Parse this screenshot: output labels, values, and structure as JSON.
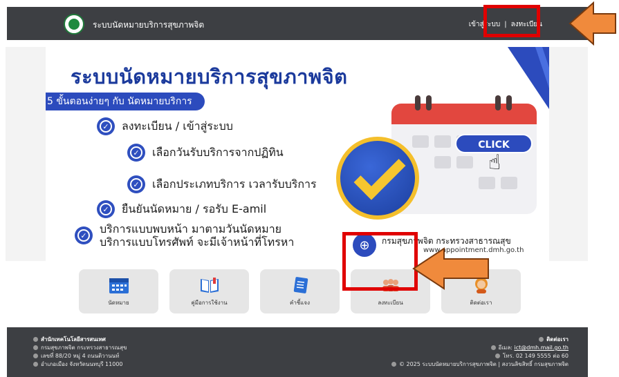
{
  "header": {
    "site_title": "ระบบนัดหมายบริการสุขภาพจิต",
    "login_link": "เข้าสู่ระบบ",
    "register_link": "ลงทะเบียน"
  },
  "banner": {
    "title": "ระบบนัดหมายบริการสุขภาพจิต",
    "steps_label": "5 ขั้นตอนง่ายๆ กับ นัดหมายบริการ",
    "steps": [
      "ลงทะเบียน / เข้าสู่ระบบ",
      "เลือกวันรับบริการจากปฏิทิน",
      "เลือกประเภทบริการ เวลารับบริการ",
      "ยืนยันนัดหมาย / รอรับ E-amil"
    ],
    "step5_line1": "บริการแบบพบหน้า มาตามวันนัดหมาย",
    "step5_line2": "บริการแบบโทรศัพท์ จะมีเจ้าหน้าที่โทรหา",
    "click_label": "CLICK",
    "ministry": "กรมสุขภาพจิต กระทรวงสาธารณสุข",
    "url": "www.appointment.dmh.go.th"
  },
  "tiles": [
    {
      "label": "นัดหมาย",
      "icon": "calendar-icon"
    },
    {
      "label": "คู่มือการใช้งาน",
      "icon": "book-icon"
    },
    {
      "label": "คำชี้แจง",
      "icon": "document-icon"
    },
    {
      "label": "ลงทะเบียน",
      "icon": "users-icon"
    },
    {
      "label": "ติดต่อเรา",
      "icon": "contact-icon"
    }
  ],
  "footer": {
    "org": "สำนักเทคโนโลยีสารสนเทศ",
    "dept": "กรมสุขภาพจิต กระทรวงสาธารณสุข",
    "address1": "เลขที่ 88/20 หมู่ 4 ถนนติวานนท์",
    "address2": "อำเภอเมือง จังหวัดนนทบุรี 11000",
    "contact_heading": "ติดต่อเรา",
    "email_label": "อีเมล",
    "email": "ict@dmh.mail.go.th",
    "phone": "โทร. 02 149 5555 ต่อ 60",
    "copyright": "© 2025 ระบบนัดหมายบริการสุขภาพจิต | สงวนลิขสิทธิ์ กรมสุขภาพจิต"
  },
  "colors": {
    "header_bg": "#3d3f43",
    "brand_blue": "#2c4bbd",
    "annotation_red": "#e00000",
    "annotation_orange": "#f08a3c"
  }
}
